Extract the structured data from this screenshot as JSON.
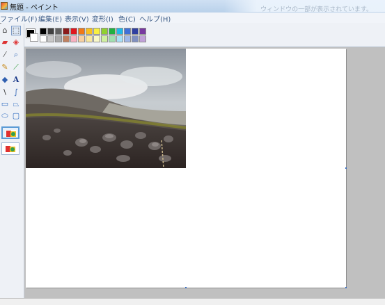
{
  "window": {
    "title": "無題 - ペイント",
    "background_title_text": "ウィンドウの一部が表示されています。"
  },
  "menu": [
    "ファイル(F)",
    "編集(E)",
    "表示(V)",
    "変形(I)",
    "色(C)",
    "ヘルプ(H)"
  ],
  "tools": [
    {
      "name": "free-select-icon",
      "glyph": "⌂"
    },
    {
      "name": "rect-select-icon",
      "glyph": "⬚"
    },
    {
      "name": "eraser-icon",
      "glyph": "▰"
    },
    {
      "name": "fill-bucket-icon",
      "glyph": "◈"
    },
    {
      "name": "color-picker-icon",
      "glyph": "⁄"
    },
    {
      "name": "magnifier-icon",
      "glyph": "⌕"
    },
    {
      "name": "pencil-icon",
      "glyph": "✎"
    },
    {
      "name": "brush-icon",
      "glyph": "⟋"
    },
    {
      "name": "airbrush-icon",
      "glyph": "◆"
    },
    {
      "name": "text-icon",
      "glyph": "A"
    },
    {
      "name": "line-icon",
      "glyph": "\\"
    },
    {
      "name": "curve-icon",
      "glyph": "∫"
    },
    {
      "name": "rectangle-icon",
      "glyph": "▭"
    },
    {
      "name": "polygon-icon",
      "glyph": "⏢"
    },
    {
      "name": "ellipse-icon",
      "glyph": "⬭"
    },
    {
      "name": "rounded-rect-icon",
      "glyph": "▢"
    }
  ],
  "colors": {
    "foreground": "#000000",
    "background": "#ffffff",
    "palette_top": [
      "#000000",
      "#404040",
      "#606060",
      "#8b1a1a",
      "#e0161e",
      "#f07818",
      "#f8c020",
      "#f8f040",
      "#90d030",
      "#20b040",
      "#20b8e8",
      "#4070d8",
      "#3040a0",
      "#7838a0"
    ],
    "palette_bottom": [
      "#ffffff",
      "#c8c8c8",
      "#a8a8a8",
      "#c08060",
      "#f8b0c0",
      "#f8d0a0",
      "#f8e8a0",
      "#f8f8c8",
      "#d0f0a0",
      "#a0e0b0",
      "#a8e0f8",
      "#a0b8e8",
      "#8090c0",
      "#c0a0d8"
    ]
  }
}
